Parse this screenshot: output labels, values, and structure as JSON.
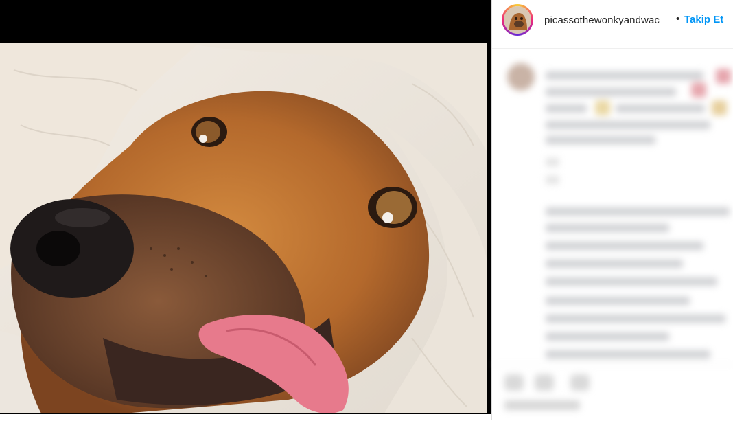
{
  "post": {
    "username": "picassothewonkyandwac",
    "separator": "•",
    "follow_label": "Takip Et",
    "follow_color": "#0095f6"
  },
  "media": {
    "subject": "dog-photo"
  },
  "comments": {
    "state": "blurred"
  }
}
